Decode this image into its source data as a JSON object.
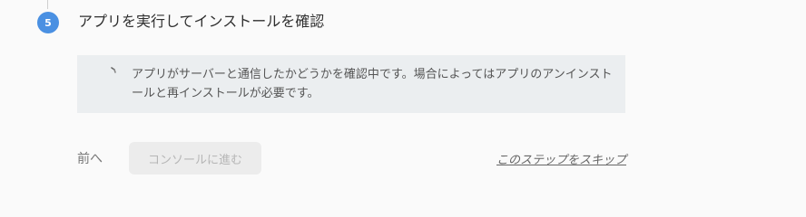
{
  "step": {
    "number": "5",
    "title": "アプリを実行してインストールを確認"
  },
  "status": {
    "icon": "spinner-icon",
    "message": "アプリがサーバーと通信したかどうかを確認中です。場合によってはアプリのアンインストールと再インストールが必要です。"
  },
  "nav": {
    "back_label": "前へ",
    "continue_label": "コンソールに進む",
    "skip_label": "このステップをスキップ"
  },
  "colors": {
    "accent": "#4a90e2",
    "panel_background": "#ebeef0"
  }
}
